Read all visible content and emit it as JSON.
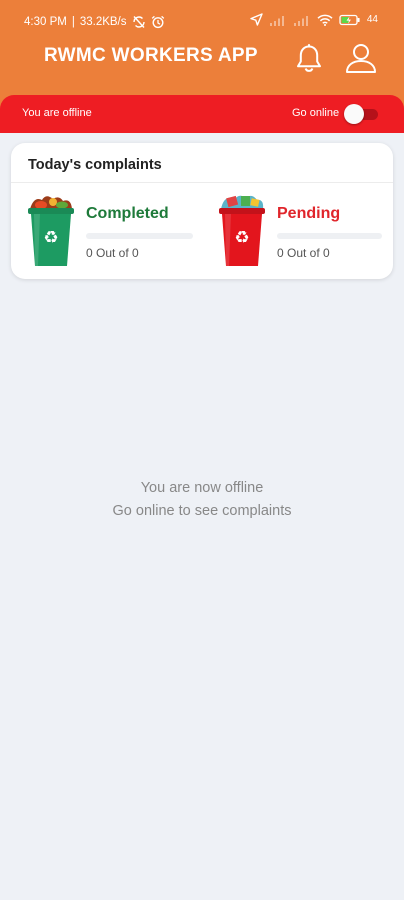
{
  "status_bar": {
    "time": "4:30 PM",
    "network_speed": "33.2KB/s",
    "battery": "44"
  },
  "app_bar": {
    "title": "RWMC WORKERS APP",
    "notification_icon": "bell-icon",
    "profile_icon": "user-icon"
  },
  "connection_bar": {
    "status_text": "You are offline",
    "toggle_label": "Go online",
    "toggle_on": false
  },
  "complaints_card": {
    "title": "Today's complaints",
    "completed": {
      "label": "Completed",
      "count_text": "0 Out of 0",
      "progress": 0,
      "color": "#1e7a3a"
    },
    "pending": {
      "label": "Pending",
      "count_text": "0 Out of 0",
      "progress": 0,
      "color": "#e0252b"
    }
  },
  "empty_state": {
    "line1": "You are now offline",
    "line2": "Go online to see complaints"
  },
  "colors": {
    "header": "#ec7f3a",
    "offline_bar": "#ee1d23",
    "background": "#eef1f6"
  }
}
